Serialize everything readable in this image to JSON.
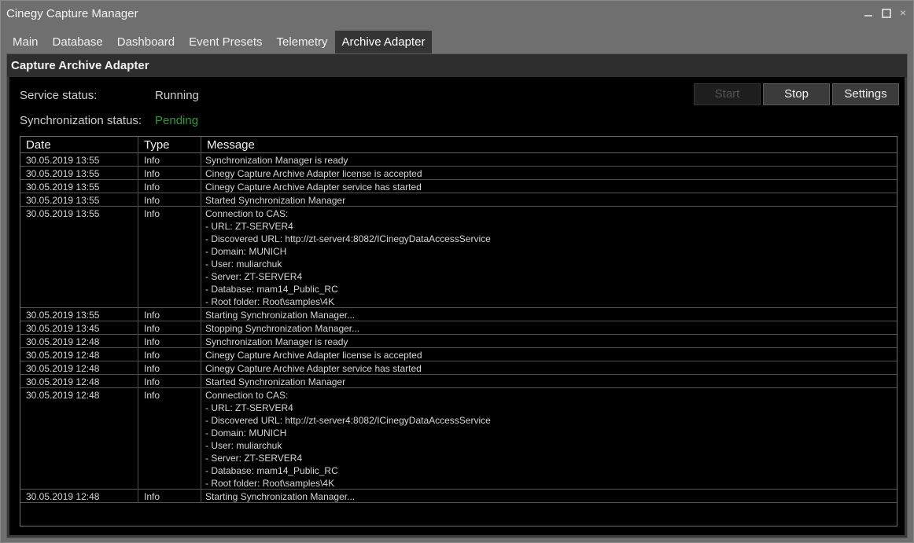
{
  "window": {
    "title": "Cinegy Capture Manager",
    "controls": {
      "minimize": "minimize-icon",
      "maximize": "maximize-icon",
      "close": "×"
    }
  },
  "tabs": [
    {
      "label": "Main"
    },
    {
      "label": "Database"
    },
    {
      "label": "Dashboard"
    },
    {
      "label": "Event Presets"
    },
    {
      "label": "Telemetry"
    },
    {
      "label": "Archive Adapter",
      "active": true
    }
  ],
  "panel": {
    "title": "Capture Archive Adapter",
    "service_status": {
      "label": "Service status:",
      "value": "Running"
    },
    "sync_status": {
      "label": "Synchronization status:",
      "value": "Pending",
      "color": "#2e9a36"
    },
    "buttons": {
      "start": "Start",
      "stop": "Stop",
      "settings": "Settings"
    }
  },
  "log": {
    "columns": [
      "Date",
      "Type",
      "Message"
    ],
    "rows": [
      {
        "date": "30.05.2019 13:55",
        "type": "Info",
        "message": [
          "Synchronization Manager is ready"
        ]
      },
      {
        "date": "30.05.2019 13:55",
        "type": "Info",
        "message": [
          "Cinegy Capture Archive Adapter license is accepted"
        ]
      },
      {
        "date": "30.05.2019 13:55",
        "type": "Info",
        "message": [
          "Cinegy Capture Archive Adapter service has started"
        ]
      },
      {
        "date": "30.05.2019 13:55",
        "type": "Info",
        "message": [
          "Started Synchronization Manager"
        ]
      },
      {
        "date": "30.05.2019 13:55",
        "type": "Info",
        "message": [
          "Connection to CAS:",
          "- URL: ZT-SERVER4",
          "- Discovered URL: http://zt-server4:8082/ICinegyDataAccessService",
          "- Domain: MUNICH",
          "- User: muliarchuk",
          "- Server: ZT-SERVER4",
          "- Database: mam14_Public_RC",
          "- Root folder: Root\\samples\\4K"
        ]
      },
      {
        "date": "30.05.2019 13:55",
        "type": "Info",
        "message": [
          "Starting Synchronization Manager..."
        ]
      },
      {
        "date": "30.05.2019 13:45",
        "type": "Info",
        "message": [
          "Stopping Synchronization Manager..."
        ]
      },
      {
        "date": "30.05.2019 12:48",
        "type": "Info",
        "message": [
          "Synchronization Manager is ready"
        ]
      },
      {
        "date": "30.05.2019 12:48",
        "type": "Info",
        "message": [
          "Cinegy Capture Archive Adapter license is accepted"
        ]
      },
      {
        "date": "30.05.2019 12:48",
        "type": "Info",
        "message": [
          "Cinegy Capture Archive Adapter service has started"
        ]
      },
      {
        "date": "30.05.2019 12:48",
        "type": "Info",
        "message": [
          "Started Synchronization Manager"
        ]
      },
      {
        "date": "30.05.2019 12:48",
        "type": "Info",
        "message": [
          "Connection to CAS:",
          "- URL: ZT-SERVER4",
          "- Discovered URL: http://zt-server4:8082/ICinegyDataAccessService",
          "- Domain: MUNICH",
          "- User: muliarchuk",
          "- Server: ZT-SERVER4",
          "- Database: mam14_Public_RC",
          "- Root folder: Root\\samples\\4K"
        ]
      },
      {
        "date": "30.05.2019 12:48",
        "type": "Info",
        "message": [
          "Starting Synchronization Manager..."
        ]
      }
    ]
  }
}
